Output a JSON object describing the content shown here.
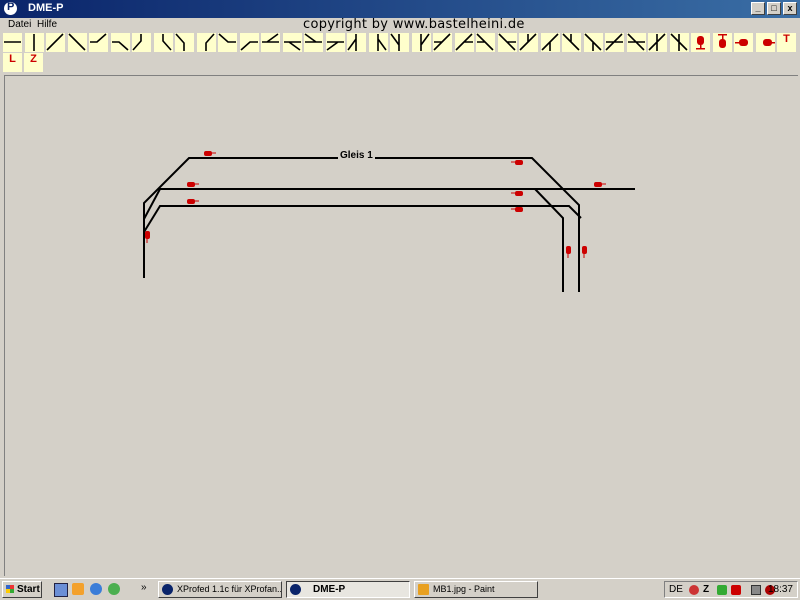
{
  "window": {
    "title": "DME-P",
    "controls": [
      "_",
      "□",
      "x"
    ]
  },
  "menu": {
    "items": [
      "Datei",
      "Hilfe"
    ]
  },
  "banner": {
    "copyright": "copyright by www.bastelheini.de"
  },
  "toolbar": {
    "row1_tools": [
      "track-horizontal",
      "track-vertical",
      "track-diagonal-up",
      "track-diagonal-down",
      "track-curve-a",
      "track-curve-b",
      "track-curve-c",
      "track-curve-d",
      "track-curve-e",
      "track-curve-f",
      "track-curve-g",
      "track-curve-h",
      "switch-a",
      "switch-b",
      "switch-c",
      "switch-d",
      "switch-e",
      "switch-f",
      "switch-g",
      "switch-h",
      "switch-i",
      "switch-j",
      "switch-k",
      "switch-l",
      "switch-m",
      "switch-n",
      "switch-o",
      "switch-p",
      "switch-q",
      "switch-r",
      "switch-s",
      "switch-t",
      "signal-up",
      "signal-down",
      "signal-right",
      "signal-left"
    ],
    "text_tool": "T",
    "row2_tools": [
      "L",
      "Z"
    ]
  },
  "layout": {
    "track_label": "Gleis 1"
  },
  "taskbar": {
    "start_label": "Start",
    "quicklaunch": [
      "desktop-icon",
      "media-icon",
      "ie-icon",
      "network-icon"
    ],
    "overflow": "»",
    "tasks": [
      {
        "label": "XProfed 1.1c für XProfan...",
        "active": false
      },
      {
        "label": "DME-P",
        "active": true
      },
      {
        "label": "MB1.jpg - Paint",
        "active": false
      }
    ],
    "tray": {
      "lang": "DE",
      "time": "18:37"
    }
  },
  "colors": {
    "titlebar": "#0a246a",
    "toolbar_button": "#ffffcc",
    "signal": "#cc0000",
    "track": "#000000",
    "background": "#d4d0c8"
  }
}
